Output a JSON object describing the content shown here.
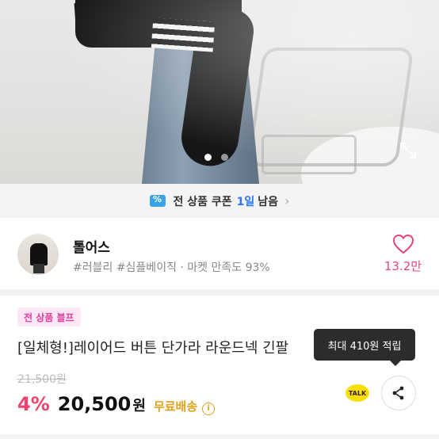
{
  "hero": {
    "dots_count": 2,
    "active_dot": 0
  },
  "coupon_banner": {
    "label": "전 상품 쿠폰",
    "highlight": "1일",
    "suffix": "남음",
    "chevron": "›"
  },
  "store": {
    "name": "톨어스",
    "tags": "#러블리 #심플베이직 · 마켓 만족도 93%",
    "likes": "13.2만"
  },
  "product": {
    "badge": "전 상품 블프",
    "title": "[일체형!]레이어드 버튼 단가라 라운드넥 긴팔",
    "original_price": "21,500원",
    "discount": "4%",
    "price": "20,500",
    "currency": "원",
    "shipping": "무료배송",
    "info_icon_glyph": "i"
  },
  "tooltip": {
    "text": "최대 410원 적립"
  },
  "actions": {
    "talk_label": "TALK"
  },
  "colors": {
    "accent_pink": "#f0436e",
    "coupon_blue": "#2b74ff",
    "shipping_gold": "#e0a21c",
    "kakao_yellow": "#f9e000"
  }
}
